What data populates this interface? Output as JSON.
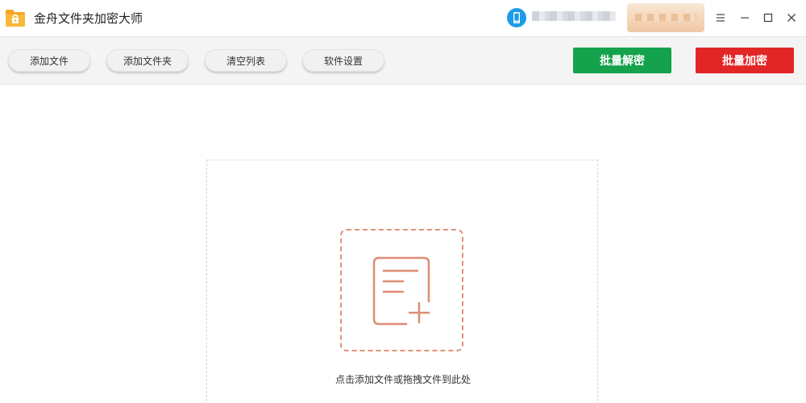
{
  "window": {
    "title": "金舟文件夹加密大师",
    "controls": [
      "menu-icon",
      "minimize-icon",
      "maximize-icon",
      "close-icon"
    ]
  },
  "toolbar": {
    "add_file": "添加文件",
    "add_folder": "添加文件夹",
    "clear_list": "清空列表",
    "settings": "软件设置",
    "batch_decrypt": "批量解密",
    "batch_encrypt": "批量加密"
  },
  "colors": {
    "decrypt": "#14a24c",
    "encrypt": "#e22626",
    "drop_accent": "#e0917a",
    "logo": "#f5a623"
  },
  "drop_zone": {
    "hint": "点击添加文件或拖拽文件到此处",
    "icon": "document-add-icon"
  }
}
